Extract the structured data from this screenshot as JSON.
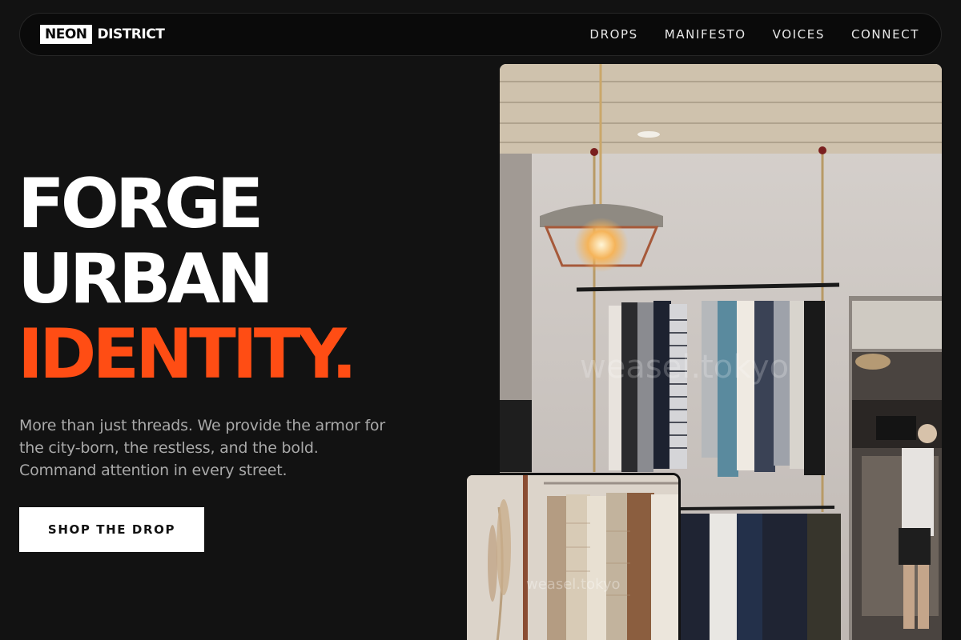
{
  "brand": {
    "box": "NEON",
    "word": "DISTRICT"
  },
  "nav": {
    "items": [
      "DROPS",
      "MANIFESTO",
      "VOICES",
      "CONNECT"
    ]
  },
  "hero": {
    "line1": "FORGE",
    "line2": "URBAN",
    "line3": "IDENTITY.",
    "lede": "More than just threads. We provide the armor for the city-born, the restless, and the bold. Command attention in every street.",
    "cta": "SHOP THE DROP"
  },
  "images": {
    "main_watermark": "weasel.tokyo",
    "sub_watermark": "weasel.tokyo"
  },
  "colors": {
    "accent": "#ff4d14",
    "background": "#121212",
    "nav_bg": "#0a0a0a"
  }
}
